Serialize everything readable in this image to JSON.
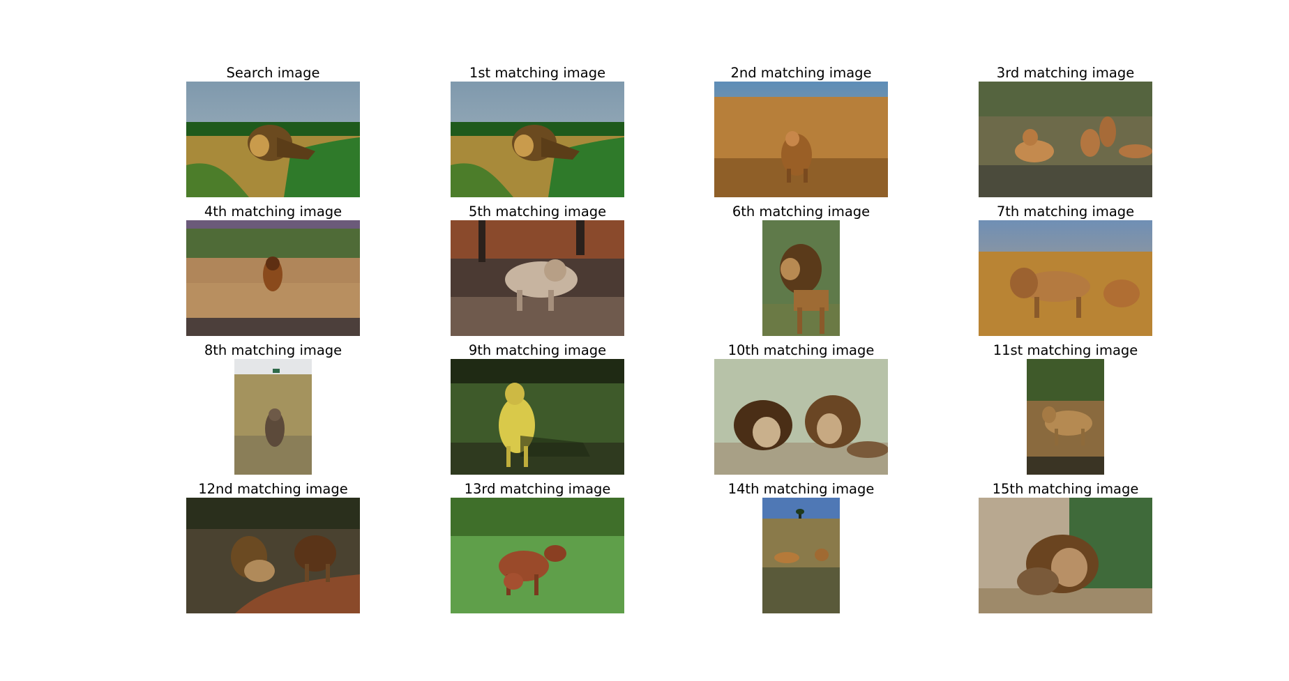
{
  "grid": {
    "cells": [
      {
        "title": "Search image",
        "subject": "male lion in grass with green bushes",
        "orientation": "landscape"
      },
      {
        "title": "1st matching image",
        "subject": "male lion in grass with green bushes",
        "orientation": "landscape"
      },
      {
        "title": "2nd matching image",
        "subject": "lion walking on savanna",
        "orientation": "landscape"
      },
      {
        "title": "3rd matching image",
        "subject": "lioness and cubs lying in grass",
        "orientation": "landscape"
      },
      {
        "title": "4th matching image",
        "subject": "lion walking toward camera",
        "orientation": "landscape"
      },
      {
        "title": "5th matching image",
        "subject": "pale lion walking among leaves",
        "orientation": "landscape"
      },
      {
        "title": "6th matching image",
        "subject": "male lion standing, side profile",
        "orientation": "portrait"
      },
      {
        "title": "7th matching image",
        "subject": "two lions in golden grass",
        "orientation": "landscape"
      },
      {
        "title": "8th matching image",
        "subject": "lion sitting in grassland",
        "orientation": "portrait"
      },
      {
        "title": "9th matching image",
        "subject": "golden dog standing on lawn",
        "orientation": "landscape"
      },
      {
        "title": "10th matching image",
        "subject": "two male lions lying down",
        "orientation": "landscape"
      },
      {
        "title": "11st matching image",
        "subject": "lioness standing near bushes",
        "orientation": "portrait"
      },
      {
        "title": "12nd matching image",
        "subject": "two male lions walking on path",
        "orientation": "landscape"
      },
      {
        "title": "13rd matching image",
        "subject": "horse and foal on green grass",
        "orientation": "landscape"
      },
      {
        "title": "14th matching image",
        "subject": "lions lying on savanna with tree",
        "orientation": "portrait"
      },
      {
        "title": "15th matching image",
        "subject": "male lion close-up, green background",
        "orientation": "landscape"
      }
    ]
  },
  "colors": {
    "background": "#ffffff",
    "title_text": "#000000"
  }
}
